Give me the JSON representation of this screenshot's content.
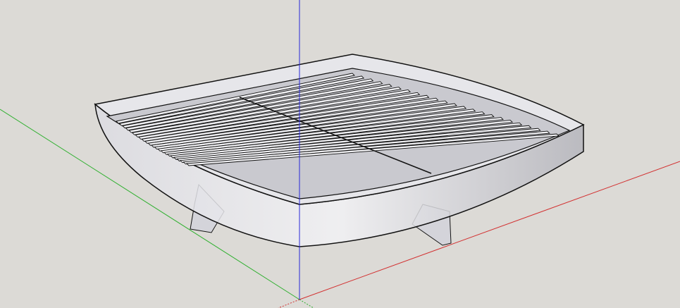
{
  "viewport": {
    "background": "#dcdad6",
    "axes": {
      "red": "#d23030",
      "green": "#30b030",
      "blue": "#2828d8"
    },
    "model": {
      "edge": "#111111",
      "fill": "#e6e6ea",
      "shade": "#b8b8bf",
      "slat": "#8e8e94"
    }
  }
}
